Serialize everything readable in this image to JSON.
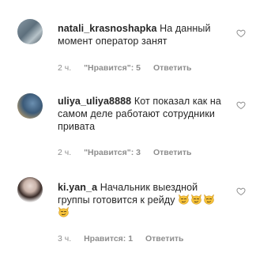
{
  "comments": [
    {
      "username": "natali_krasnoshapka",
      "text": "На данный момент оператор занят",
      "time": "2 ч.",
      "likes": "\"Нравится\": 5",
      "reply": "Ответить"
    },
    {
      "username": "uliya_uliya8888",
      "text": "Кот показал как на самом деле работают сотрудники привата",
      "time": "2 ч.",
      "likes": "\"Нравится\": 3",
      "reply": "Ответить"
    },
    {
      "username": "ki.yan_a",
      "text": "Начальник выездной группы готовится к рейду",
      "emoji": "smirking-cat-face",
      "emoji_count": 4,
      "time": "3 ч.",
      "likes": "Нравится: 1",
      "reply": "Ответить"
    }
  ],
  "icons": {
    "like": "heart-outline-icon"
  },
  "colors": {
    "text": "#262626",
    "meta": "#8e8e8e",
    "heart_stroke": "#8e8e8e",
    "emoji_face": "#f7c33b"
  }
}
